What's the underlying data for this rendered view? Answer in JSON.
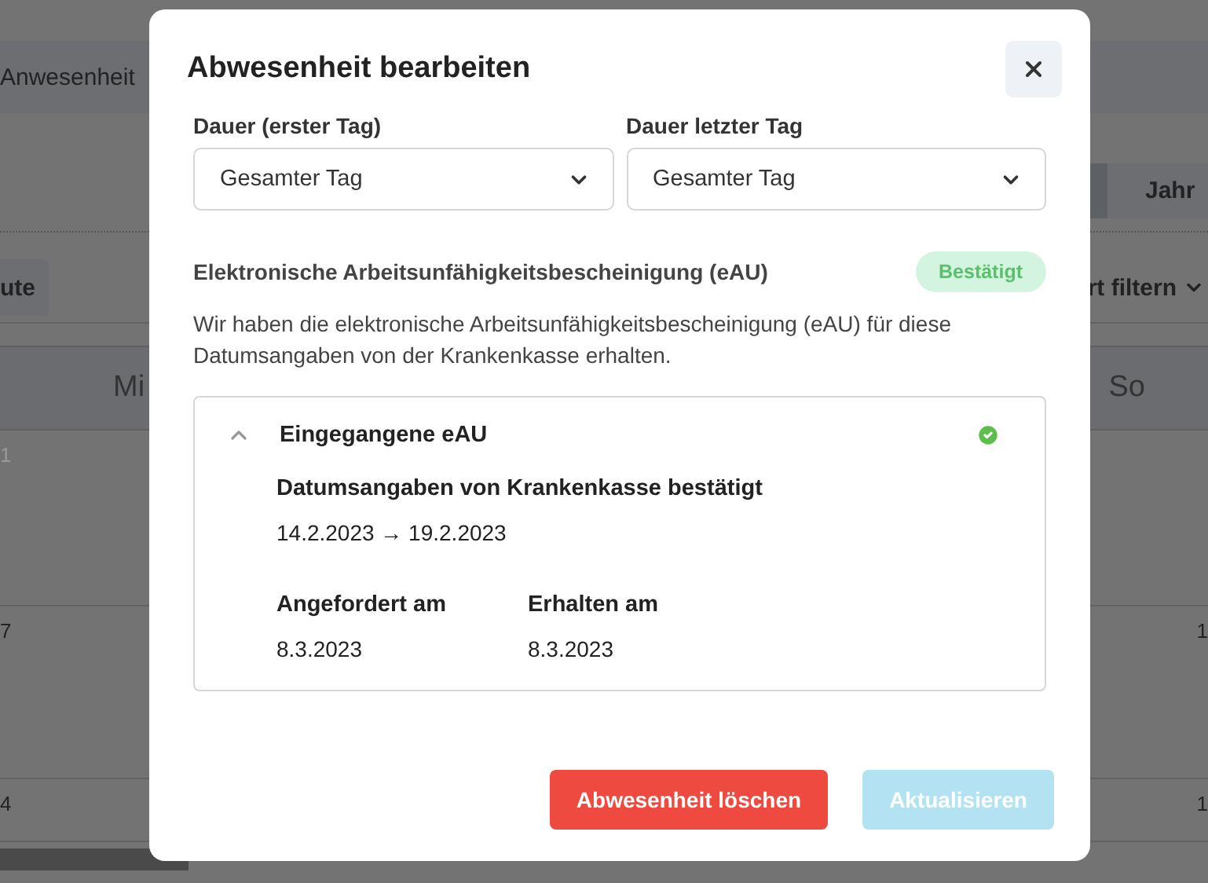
{
  "background": {
    "tab": "Anwesenheit",
    "view_button": "Jahr",
    "left_button": "ute",
    "filter": "rt filtern",
    "weekdays": [
      "Mi",
      "So"
    ],
    "left_days": [
      "1",
      "7",
      "4"
    ],
    "right_days": [
      "1",
      "1"
    ]
  },
  "dialog": {
    "title": "Abwesenheit bearbeiten",
    "fields": [
      {
        "label": "Dauer (erster Tag)",
        "value": "Gesamter Tag"
      },
      {
        "label": "Dauer letzter Tag",
        "value": "Gesamter Tag"
      }
    ],
    "eau": {
      "title": "Elektronische Arbeitsunfähigkeitsbescheinigung (eAU)",
      "status": "Bestätigt",
      "description": "Wir haben die elektronische Arbeitsunfähigkeitsbescheinigung (eAU) für diese Datumsangaben von der Krankenkasse erhalten.",
      "panel": {
        "title": "Eingegangene eAU",
        "expanded": true,
        "confirmed": true,
        "subtitle": "Datumsangaben von Krankenkasse bestätigt",
        "range": "14.2.2023 → 19.2.2023",
        "details": [
          {
            "label": "Angefordert am",
            "value": "8.3.2023"
          },
          {
            "label": "Erhalten am",
            "value": "8.3.2023"
          }
        ]
      }
    },
    "buttons": [
      {
        "label": "Abwesenheit löschen",
        "kind": "danger",
        "disabled": false
      },
      {
        "label": "Aktualisieren",
        "kind": "primary",
        "disabled": true
      }
    ]
  }
}
